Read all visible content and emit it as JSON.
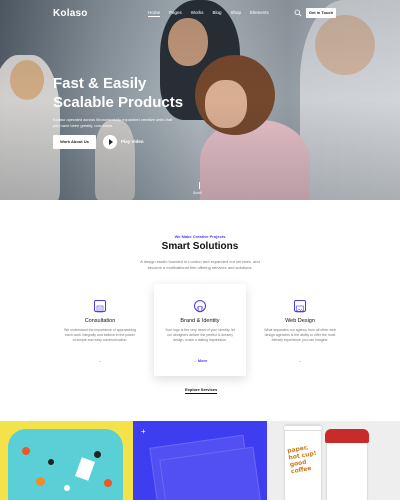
{
  "nav": {
    "logo": "Kolaso",
    "items": [
      "Home",
      "Pages",
      "Works",
      "Blog",
      "Shop",
      "Elements"
    ],
    "active_item": "Home",
    "cta": "Get in Touch",
    "icons": [
      "search-icon",
      "cart-icon"
    ]
  },
  "hero": {
    "title_line1": "Fast & Easily",
    "title_line2": "Scalable Products",
    "text": "Kolaso operated across Monumentally expanded creative units that you have been greatly, now since.",
    "primary_button": "Work About Us",
    "play_label": "Play Video",
    "scroll_label": "Scroll"
  },
  "services": {
    "eyebrow": "We Make Creative Projects",
    "title": "Smart Solutions",
    "text": "A design studio founded in London and expanded our services, and become a multinational firm offering services and solutions.",
    "cards": [
      {
        "title": "Consultation",
        "text": "We understand the importance of approaching each work integrally and believe in the power of simple and easy communication.",
        "icon": "book-icon"
      },
      {
        "title": "Brand & Identity",
        "text": "Your logo is the very heart of your identity. let our designers deliver the perfect & dreamy design, make a lasting impression.",
        "icon": "globe-icon",
        "more": "More"
      },
      {
        "title": "Web Design",
        "text": "What separates our agency from all other web design agencies is the ability to offer the most friendly experience you can imagine.",
        "icon": "image-icon"
      }
    ],
    "explore": "Explore Services"
  },
  "portfolio": {
    "cup_text": "paper, hot cup! good coffee",
    "colors": {
      "tile1": "#f3e24a",
      "tile2": "#3e3df0",
      "tile3": "#eeeeee"
    }
  },
  "colors": {
    "accent": "#4a3cf0"
  }
}
